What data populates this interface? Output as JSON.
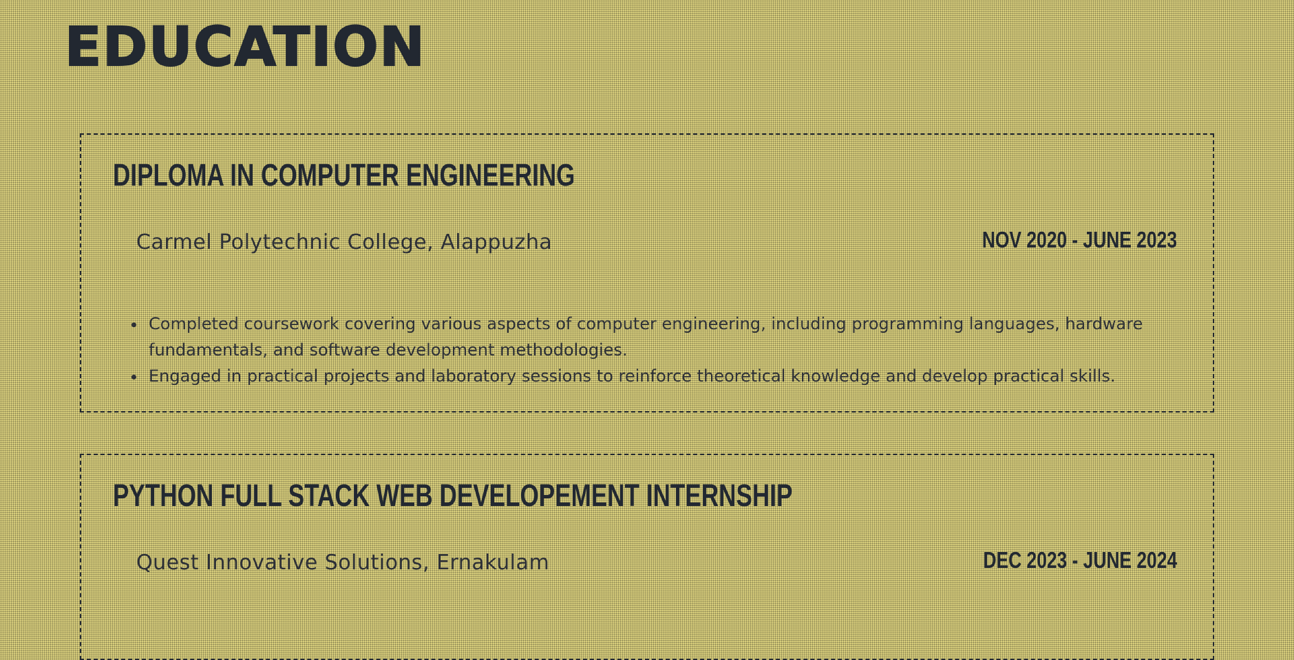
{
  "section": {
    "title": "EDUCATION"
  },
  "entries": [
    {
      "degree": "DIPLOMA IN COMPUTER ENGINEERING",
      "institution": "Carmel Polytechnic College, Alappuzha",
      "dates": "NOV 2020 - JUNE 2023",
      "highlights": [
        "Completed coursework covering various aspects of computer engineering, including programming languages, hardware fundamentals, and software development methodologies.",
        "Engaged in practical projects and laboratory sessions to reinforce theoretical knowledge and develop practical skills."
      ]
    },
    {
      "degree": "PYTHON FULL STACK WEB DEVELOPEMENT INTERNSHIP",
      "institution": "Quest Innovative Solutions, Ernakulam",
      "dates": "DEC 2023 - JUNE 2024"
    }
  ],
  "colors": {
    "background": "#ddd27f",
    "text": "#222831"
  }
}
